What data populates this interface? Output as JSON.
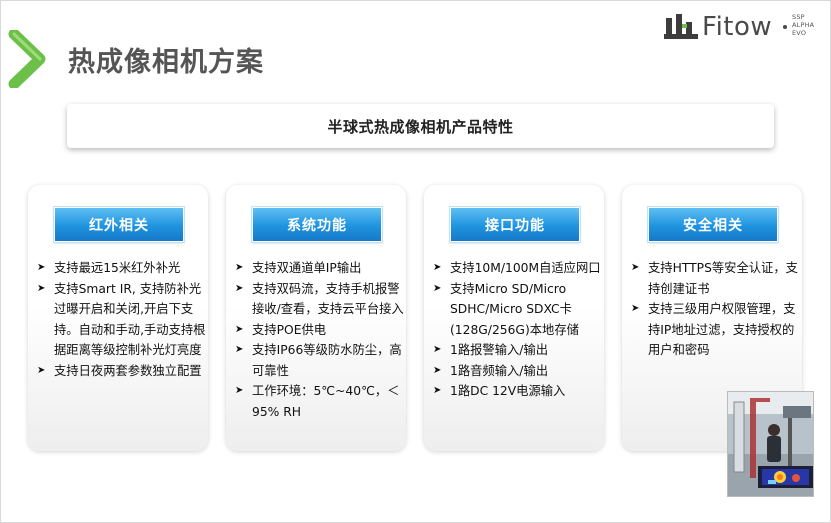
{
  "header": {
    "title": "热成像相机方案",
    "logo": {
      "word": "Fitow",
      "sub": [
        "SSP",
        "ALPHA",
        "EVO"
      ]
    }
  },
  "banner": {
    "text": "半球式热成像相机产品特性"
  },
  "cards": [
    {
      "title": "红外相关",
      "items": [
        "支持最远15米红外补光",
        "支持Smart IR, 支持防补光过曝开启和关闭,开启下支持。自动和手动,手动支持根据距离等级控制补光灯亮度",
        "支持日夜两套参数独立配置"
      ]
    },
    {
      "title": "系统功能",
      "items": [
        "支持双通道单IP输出",
        "支持双码流，支持手机报警接收/查看，支持云平台接入",
        "支持POE供电",
        "支持IP66等级防水防尘，高可靠性",
        "工作环境：5℃~40℃，＜95% RH"
      ]
    },
    {
      "title": "接口功能",
      "items": [
        "支持10M/100M自适应网口",
        "支持Micro SD/Micro SDHC/Micro SDXC卡(128G/256G)本地存储",
        "1路报警输入/输出",
        "1路音频输入/输出",
        "1路DC 12V电源输入"
      ]
    },
    {
      "title": "安全相关",
      "items": [
        "支持HTTPS等安全认证，支持创建证书",
        "支持三级用户权限管理，支持IP地址过滤，支持授权的用户和密码"
      ]
    }
  ],
  "colors": {
    "chevron_green": "#6cc04a",
    "header_blue": "#1f93df",
    "title_gray": "#555555"
  }
}
